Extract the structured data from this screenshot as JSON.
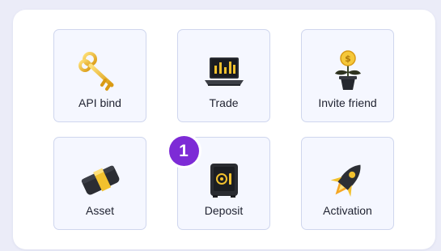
{
  "menu": {
    "items": [
      {
        "label": "API bind",
        "icon": "key-icon"
      },
      {
        "label": "Trade",
        "icon": "laptop-chart-icon"
      },
      {
        "label": "Invite friend",
        "icon": "coin-plant-icon"
      },
      {
        "label": "Asset",
        "icon": "wallet-icon"
      },
      {
        "label": "Deposit",
        "icon": "safe-icon"
      },
      {
        "label": "Activation",
        "icon": "rocket-icon"
      }
    ]
  },
  "step_badge": {
    "number": "1"
  },
  "colors": {
    "page_background": "#ebecf8",
    "tile_background": "#f5f7ff",
    "tile_border": "#cfd6ee",
    "badge": "#7d2bd6",
    "gold": "#f2c12e"
  }
}
